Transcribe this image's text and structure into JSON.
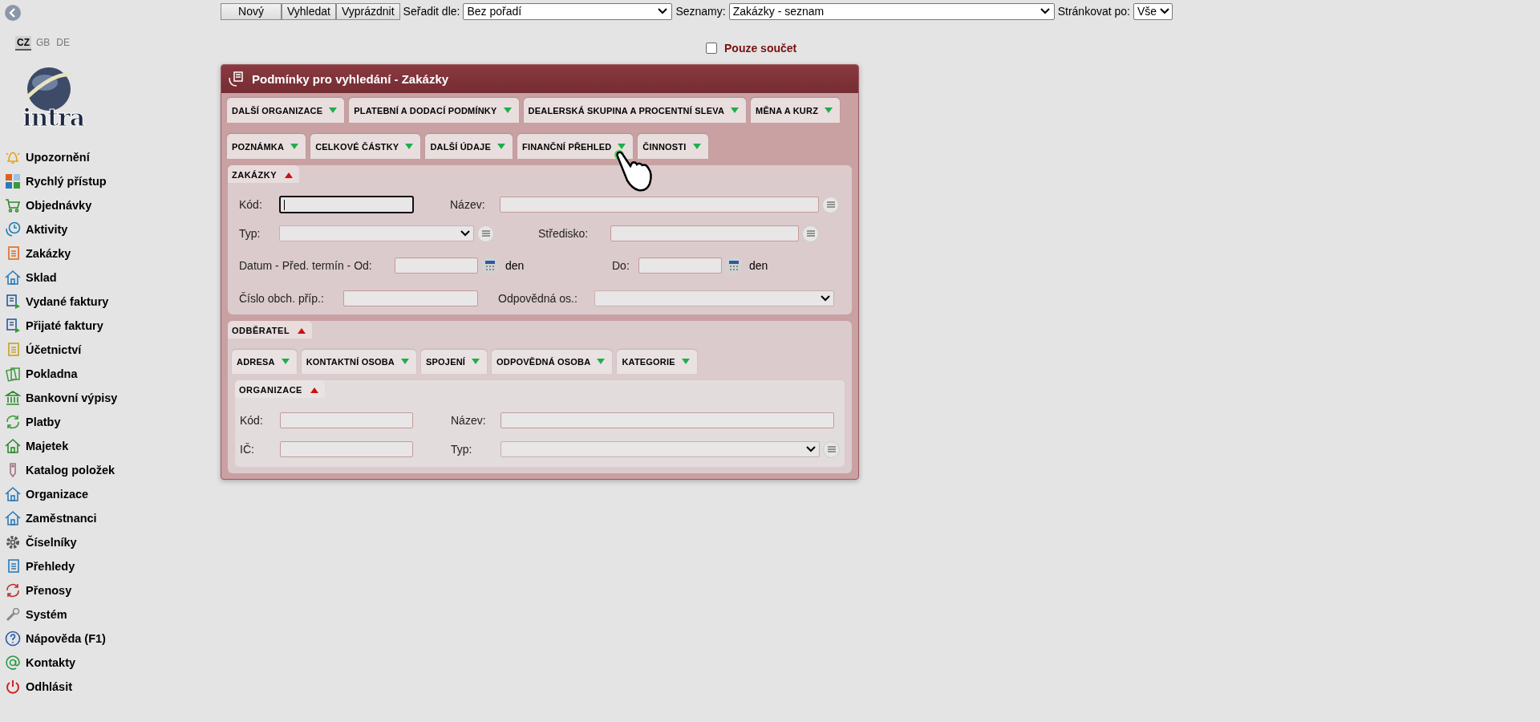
{
  "languages": [
    {
      "label": "CZ",
      "selected": true
    },
    {
      "label": "GB",
      "selected": false
    },
    {
      "label": "DE",
      "selected": false
    }
  ],
  "logo": {
    "text": "intra"
  },
  "menu": [
    "Upozornění",
    "Rychlý přístup",
    "Objednávky",
    "Aktivity",
    "Zakázky",
    "Sklad",
    "Vydané faktury",
    "Přijaté faktury",
    "Účetnictví",
    "Pokladna",
    "Bankovní výpisy",
    "Platby",
    "Majetek",
    "Katalog položek",
    "Organizace",
    "Zaměstnanci",
    "Číselníky",
    "Přehledy",
    "Přenosy",
    "Systém",
    "Nápověda (F1)",
    "Kontakty",
    "Odhlásit"
  ],
  "toolbar": {
    "buttons": [
      "Nový",
      "Vyhledat",
      "Vyprázdnit"
    ],
    "selects": [
      {
        "label": "Seřadit dle:",
        "value": "Bez pořadí"
      },
      {
        "label": "Seznamy:",
        "value": "Zakázky - seznam"
      },
      {
        "label": "Stránkovat po:",
        "value": "Vše"
      }
    ]
  },
  "sum_only": {
    "label": "Pouze součet",
    "checked": false
  },
  "panel": {
    "title": "Podmínky pro vyhledání - Zakázky",
    "tab_rows": [
      [
        {
          "label": "DALŠÍ ORGANIZACE",
          "expanded": false
        },
        {
          "label": "PLATEBNÍ A DODACÍ PODMÍNKY",
          "expanded": false
        },
        {
          "label": "DEALERSKÁ SKUPINA A PROCENTNÍ SLEVA",
          "expanded": false
        },
        {
          "label": "MĚNA A KURZ",
          "expanded": false
        }
      ],
      [
        {
          "label": "POZNÁMKA",
          "expanded": false
        },
        {
          "label": "CELKOVÉ ČÁSTKY",
          "expanded": false
        },
        {
          "label": "DALŠÍ ÚDAJE",
          "expanded": false
        },
        {
          "label": "FINANČNÍ PŘEHLED",
          "expanded": false
        },
        {
          "label": "ČINNOSTI",
          "expanded": false
        }
      ]
    ],
    "order_section": {
      "title": "ZAKÁZKY",
      "expanded": true,
      "rows": [
        [
          {
            "label": "Kód:",
            "kind": "input",
            "focused": true,
            "list_button": false
          },
          {
            "label": "Název:",
            "kind": "input",
            "focused": false,
            "list_button": true
          }
        ],
        [
          {
            "label": "Typ:",
            "kind": "select",
            "focused": false,
            "list_button": true
          },
          {
            "label": "Středisko:",
            "kind": "input",
            "focused": false,
            "list_button": true
          }
        ],
        [
          {
            "label": "Datum - Před. termín - Od:",
            "kind": "date",
            "focused": false,
            "list_button": false,
            "unit": "den"
          },
          {
            "label": "Do:",
            "kind": "date",
            "focused": false,
            "list_button": false,
            "unit": "den"
          }
        ],
        [
          {
            "label": "Číslo obch. příp.:",
            "kind": "input",
            "focused": false,
            "list_button": false
          },
          {
            "label": "Odpovědná os.:",
            "kind": "select",
            "focused": false,
            "list_button": false
          }
        ]
      ]
    },
    "customer_section": {
      "title": "ODBĚRATEL",
      "expanded": true,
      "tabs": [
        {
          "label": "ADRESA",
          "expanded": false
        },
        {
          "label": "KONTAKTNÍ OSOBA",
          "expanded": false
        },
        {
          "label": "SPOJENÍ",
          "expanded": false
        },
        {
          "label": "ODPOVĚDNÁ OSOBA",
          "expanded": false
        },
        {
          "label": "KATEGORIE",
          "expanded": false
        }
      ],
      "organization": {
        "title": "ORGANIZACE",
        "expanded": true,
        "rows": [
          [
            {
              "label": "Kód:",
              "kind": "input",
              "focused": false,
              "list_button": false
            },
            {
              "label": "Název:",
              "kind": "input",
              "focused": false,
              "list_button": false
            }
          ],
          [
            {
              "label": "IČ:",
              "kind": "input",
              "focused": false,
              "list_button": false
            },
            {
              "label": "Typ:",
              "kind": "select",
              "focused": false,
              "list_button": true
            }
          ]
        ]
      }
    }
  }
}
